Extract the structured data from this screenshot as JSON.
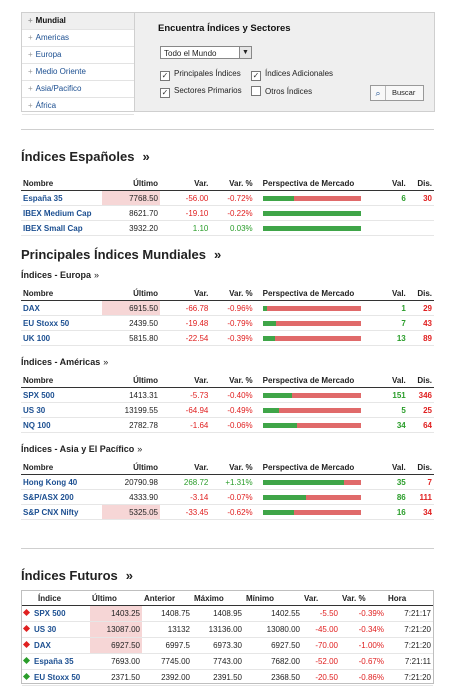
{
  "finder": {
    "regions": [
      {
        "label": "Mundial",
        "active": true
      },
      {
        "label": "Americas",
        "active": false
      },
      {
        "label": "Europa",
        "active": false
      },
      {
        "label": "Medio Oriente",
        "active": false
      },
      {
        "label": "Asia/Pacifico",
        "active": false
      },
      {
        "label": "África",
        "active": false
      }
    ],
    "title": "Encuentra Índices y Sectores",
    "select_value": "Todo el Mundo",
    "checkboxes": [
      {
        "label": "Principales Índices",
        "checked": true
      },
      {
        "label": "Índices Adicionales",
        "checked": true
      },
      {
        "label": "Sectores Primarios",
        "checked": true
      },
      {
        "label": "Otros Índices",
        "checked": false
      }
    ],
    "search_label": "Buscar"
  },
  "columns": {
    "name": "Nombre",
    "last": "Último",
    "chg": "Var.",
    "pct": "Var. %",
    "perspective": "Perspectiva de Mercado",
    "val": "Val.",
    "dis": "Dis."
  },
  "spanish": {
    "title": "Índices Españoles",
    "rows": [
      {
        "name": "España 35",
        "last": "7768.50",
        "chg": "-56.00",
        "pct": "-0.72%",
        "bull": 0.32,
        "val": "6",
        "dis": "30",
        "hl": true,
        "dir": "down"
      },
      {
        "name": "IBEX Medium Cap",
        "last": "8621.70",
        "chg": "-19.10",
        "pct": "-0.22%",
        "bull": 1.0,
        "val": "",
        "dis": "",
        "hl": false,
        "dir": "down"
      },
      {
        "name": "IBEX Small Cap",
        "last": "3932.20",
        "chg": "1.10",
        "pct": "0.03%",
        "bull": 1.0,
        "val": "",
        "dis": "",
        "hl": false,
        "dir": "up"
      }
    ]
  },
  "world": {
    "title": "Principales Índices Mundiales",
    "groups": [
      {
        "title": "Índices - Europa",
        "rows": [
          {
            "name": "DAX",
            "last": "6915.50",
            "chg": "-66.78",
            "pct": "-0.96%",
            "bull": 0.04,
            "val": "1",
            "dis": "29",
            "hl": true,
            "dir": "down"
          },
          {
            "name": "EU Stoxx 50",
            "last": "2439.50",
            "chg": "-19.48",
            "pct": "-0.79%",
            "bull": 0.14,
            "val": "7",
            "dis": "43",
            "hl": false,
            "dir": "down"
          },
          {
            "name": "UK 100",
            "last": "5815.80",
            "chg": "-22.54",
            "pct": "-0.39%",
            "bull": 0.13,
            "val": "13",
            "dis": "89",
            "hl": false,
            "dir": "down"
          }
        ]
      },
      {
        "title": "Índices - Américas",
        "rows": [
          {
            "name": "SPX 500",
            "last": "1413.31",
            "chg": "-5.73",
            "pct": "-0.40%",
            "bull": 0.3,
            "val": "151",
            "dis": "346",
            "hl": false,
            "dir": "down"
          },
          {
            "name": "US 30",
            "last": "13199.55",
            "chg": "-64.94",
            "pct": "-0.49%",
            "bull": 0.17,
            "val": "5",
            "dis": "25",
            "hl": false,
            "dir": "down"
          },
          {
            "name": "NQ 100",
            "last": "2782.78",
            "chg": "-1.64",
            "pct": "-0.06%",
            "bull": 0.35,
            "val": "34",
            "dis": "64",
            "hl": false,
            "dir": "down"
          }
        ]
      },
      {
        "title": "Índices - Asia y El Pacífico",
        "rows": [
          {
            "name": "Hong Kong 40",
            "last": "20790.98",
            "chg": "268.72",
            "pct": "+1.31%",
            "bull": 0.83,
            "val": "35",
            "dis": "7",
            "hl": false,
            "dir": "up"
          },
          {
            "name": "S&P/ASX 200",
            "last": "4333.90",
            "chg": "-3.14",
            "pct": "-0.07%",
            "bull": 0.44,
            "val": "86",
            "dis": "111",
            "hl": false,
            "dir": "down"
          },
          {
            "name": "S&P CNX Nifty",
            "last": "5325.05",
            "chg": "-33.45",
            "pct": "-0.62%",
            "bull": 0.32,
            "val": "16",
            "dis": "34",
            "hl": true,
            "dir": "down"
          }
        ]
      }
    ]
  },
  "futures": {
    "title": "Índices Futuros",
    "columns": {
      "name": "Índice",
      "last": "Último",
      "prev": "Anterior",
      "high": "Máximo",
      "low": "Mínimo",
      "chg": "Var.",
      "pct": "Var. %",
      "time": "Hora"
    },
    "rows": [
      {
        "name": "SPX 500",
        "last": "1403.25",
        "prev": "1408.75",
        "high": "1408.95",
        "low": "1402.55",
        "chg": "-5.50",
        "pct": "-0.39%",
        "time": "7:21:17",
        "dir": "down",
        "hl": true
      },
      {
        "name": "US 30",
        "last": "13087.00",
        "prev": "13132",
        "high": "13136.00",
        "low": "13080.00",
        "chg": "-45.00",
        "pct": "-0.34%",
        "time": "7:21:20",
        "dir": "down",
        "hl": true
      },
      {
        "name": "DAX",
        "last": "6927.50",
        "prev": "6997.5",
        "high": "6973.30",
        "low": "6927.50",
        "chg": "-70.00",
        "pct": "-1.00%",
        "time": "7:21:20",
        "dir": "down",
        "hl": true
      },
      {
        "name": "España 35",
        "last": "7693.00",
        "prev": "7745.00",
        "high": "7743.00",
        "low": "7682.00",
        "chg": "-52.00",
        "pct": "-0.67%",
        "time": "7:21:11",
        "dir": "up",
        "hl": false
      },
      {
        "name": "EU Stoxx 50",
        "last": "2371.50",
        "prev": "2392.00",
        "high": "2391.50",
        "low": "2368.50",
        "chg": "-20.50",
        "pct": "-0.86%",
        "time": "7:21:20",
        "dir": "up",
        "hl": false
      }
    ]
  },
  "colors": {
    "up": "#2a9d2a",
    "down": "#e02020",
    "link": "#1c4f91"
  },
  "icons": {
    "region_bullet": "bullet-icon",
    "search": "search-icon",
    "dropdown": "chevron-down-icon"
  }
}
